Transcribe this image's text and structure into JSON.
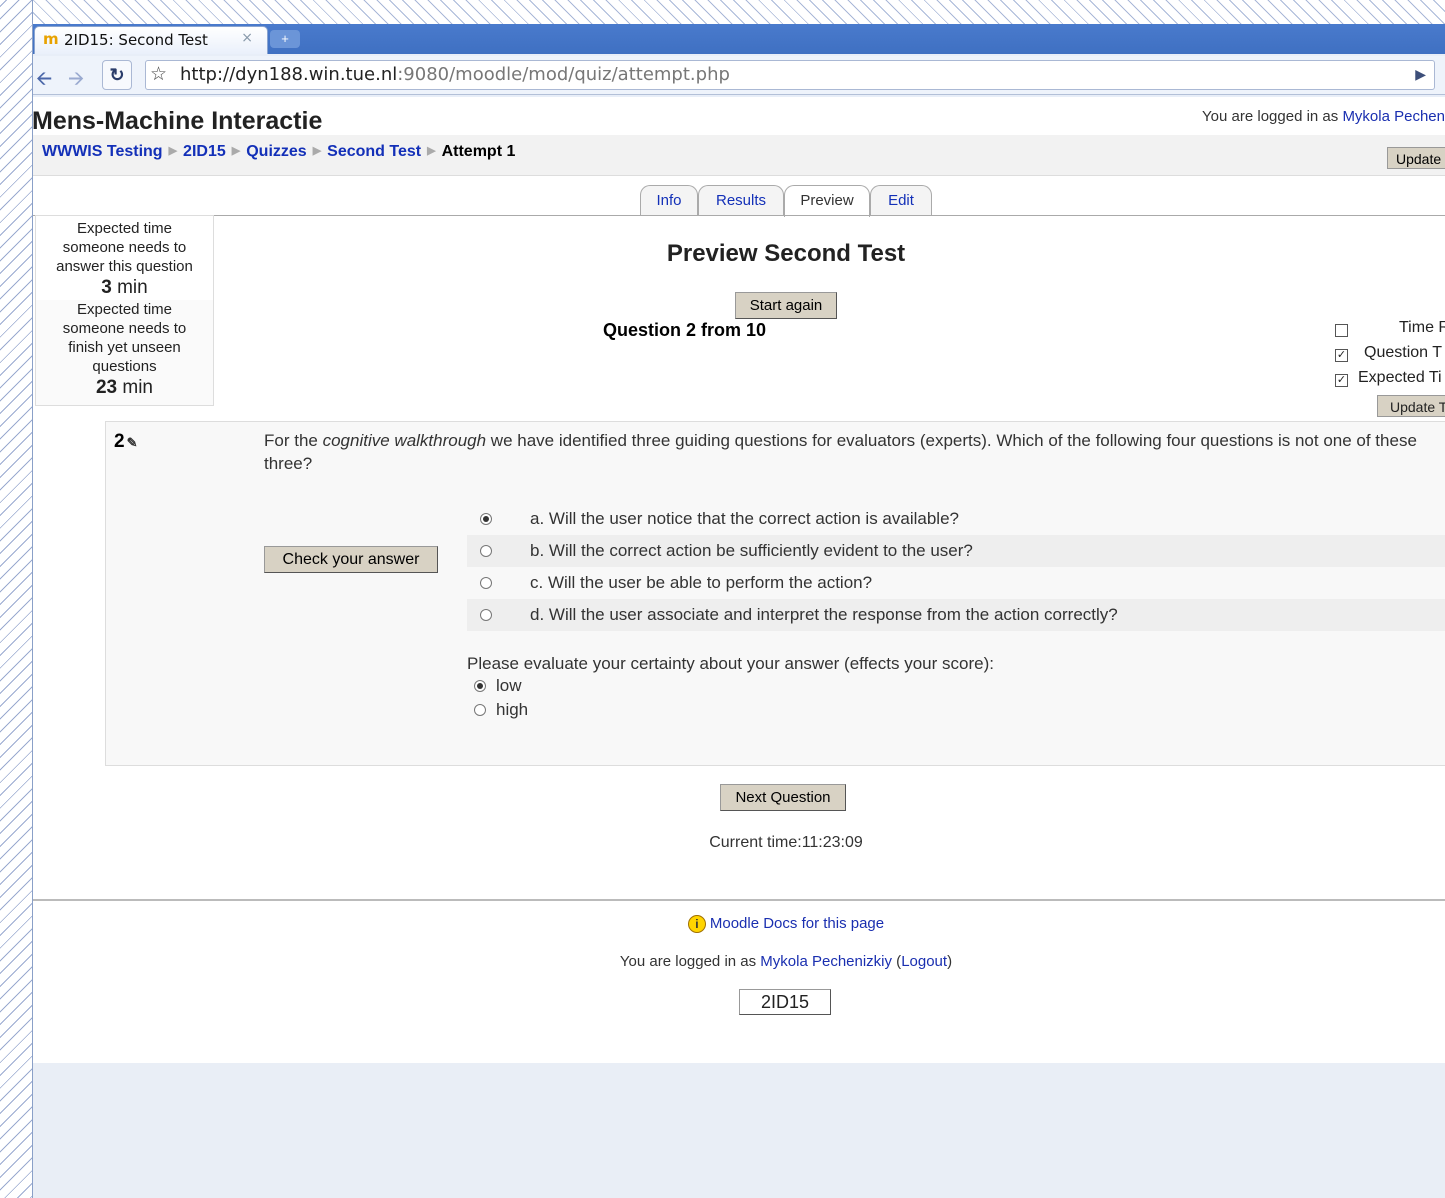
{
  "browser": {
    "tab_title": "2ID15: Second Test",
    "tab_close": "×",
    "favicon": "m",
    "new_tab": "+",
    "url_host": "http://dyn188.win.tue.nl",
    "url_rest": ":9080/moodle/mod/quiz/attempt.php"
  },
  "header": {
    "site_title": "Mens-Machine Interactie",
    "login_prefix": "You are logged in as ",
    "login_user": "Mykola Pechen"
  },
  "breadcrumb": {
    "items": [
      "WWWIS Testing",
      "2ID15",
      "Quizzes",
      "Second Test"
    ],
    "current": "Attempt 1",
    "update_label": "Update"
  },
  "tabs": [
    "Info",
    "Results",
    "Preview",
    "Edit"
  ],
  "sidebar": {
    "line1": "Expected time",
    "line2": "someone needs to",
    "line3": "answer this question",
    "value1_num": "3",
    "value1_unit": " min",
    "line4": "Expected time",
    "line5": "someone needs to",
    "line6": "finish yet unseen",
    "line7": "questions",
    "value2_num": "23",
    "value2_unit": " min"
  },
  "main": {
    "title": "Preview Second Test",
    "start_again": "Start again",
    "question_counter": "Question 2 from 10"
  },
  "settings": {
    "items": [
      {
        "label": "Time R",
        "checked": false
      },
      {
        "label": "Question T",
        "checked": true
      },
      {
        "label": "Expected Ti",
        "checked": true
      }
    ],
    "update_label": "Update T"
  },
  "question": {
    "number": "2",
    "text_before": "For the ",
    "text_italic": "cognitive walkthrough",
    "text_after": " we have identified three guiding questions for evaluators (experts). Which of the following four questions is not one of these three?",
    "check_button": "Check your answer",
    "answers": [
      "a. Will the user notice that the correct action is available?",
      "b. Will the correct action be sufficiently evident to the user?",
      "c. Will the user be able to perform the action?",
      "d. Will the user associate and interpret the response from the action correctly?"
    ],
    "selected_answer": 0,
    "certainty_prompt": "Please evaluate your certainty about your answer (effects your score):",
    "certainty_options": [
      "low",
      "high"
    ],
    "certainty_selected": 0
  },
  "navigation": {
    "next_button": "Next Question",
    "current_time": "Current time:11:23:09"
  },
  "footer": {
    "docs_link": "Moodle Docs for this page",
    "login_prefix": "You are logged in as ",
    "login_user": "Mykola Pechenizkiy",
    "logout": "Logout",
    "course_button": "2ID15"
  }
}
